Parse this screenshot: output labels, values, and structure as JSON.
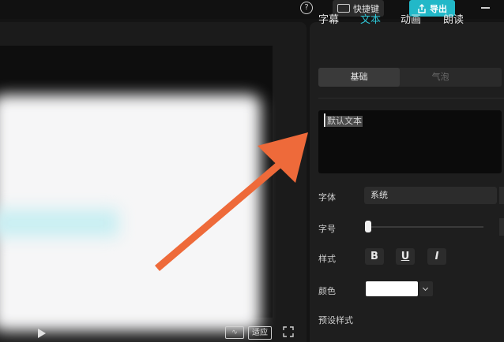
{
  "topbar": {
    "help_icon": "help-icon",
    "shortcut_label": "快捷键",
    "export_label": "导出"
  },
  "preview": {
    "ratio_label": "适应"
  },
  "panel": {
    "tabs": [
      {
        "label": "字幕",
        "active": false
      },
      {
        "label": "文本",
        "active": true
      },
      {
        "label": "动画",
        "active": false
      },
      {
        "label": "朗读",
        "active": false
      }
    ],
    "subtabs": {
      "basic": "基础",
      "bubble": "气泡"
    },
    "text_value": "默认文本",
    "font_label": "字体",
    "font_value": "系统",
    "size_label": "字号",
    "style_label": "样式",
    "style_buttons": [
      "B",
      "U",
      "I"
    ],
    "color_label": "颜色",
    "color_value": "#ffffff",
    "preset_label": "预设样式"
  },
  "colors": {
    "accent": "#2fc6d6",
    "export_button": "#22b8c8",
    "arrow": "#ee6a3a"
  }
}
